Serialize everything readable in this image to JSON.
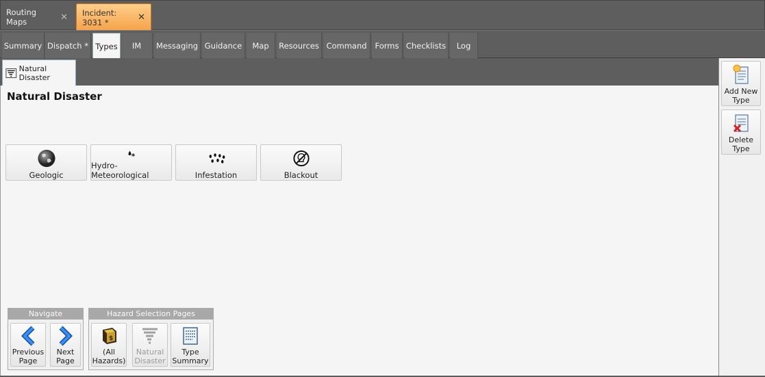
{
  "doc_tabs": [
    {
      "label": "Routing Maps",
      "close": "✕"
    },
    {
      "label": "Incident: 3031 *",
      "close": "✕"
    }
  ],
  "section_tabs": [
    "Summary",
    "Dispatch *",
    "Types",
    "IM",
    "Messaging",
    "Guidance",
    "Map",
    "Resources",
    "Command",
    "Forms",
    "Checklists",
    "Log"
  ],
  "active_section": "Types",
  "sub_tab": {
    "label": "Natural Disaster"
  },
  "page_title": "Natural Disaster",
  "type_buttons": [
    {
      "label": "Geologic",
      "icon": "globe-icon"
    },
    {
      "label": "Hydro-Meteorological",
      "icon": "drop-snow-icon"
    },
    {
      "label": "Infestation",
      "icon": "insects-icon"
    },
    {
      "label": "Blackout",
      "icon": "no-bulb-icon"
    }
  ],
  "navigate": {
    "header": "Navigate",
    "prev_line1": "Previous",
    "prev_line2": "Page",
    "next_line1": "Next",
    "next_line2": "Page"
  },
  "hazard_pages": {
    "header": "Hazard Selection Pages",
    "all_line1": "(All",
    "all_line2": "Hazards)",
    "nat_line1": "Natural",
    "nat_line2": "Disaster",
    "sum_line1": "Type",
    "sum_line2": "Summary"
  },
  "side": {
    "add_line1": "Add New",
    "add_line2": "Type",
    "del_line1": "Delete",
    "del_line2": "Type"
  },
  "colors": {
    "active_doc_tab": "#f6a24a",
    "nav_arrow": "#1a6fd1"
  }
}
